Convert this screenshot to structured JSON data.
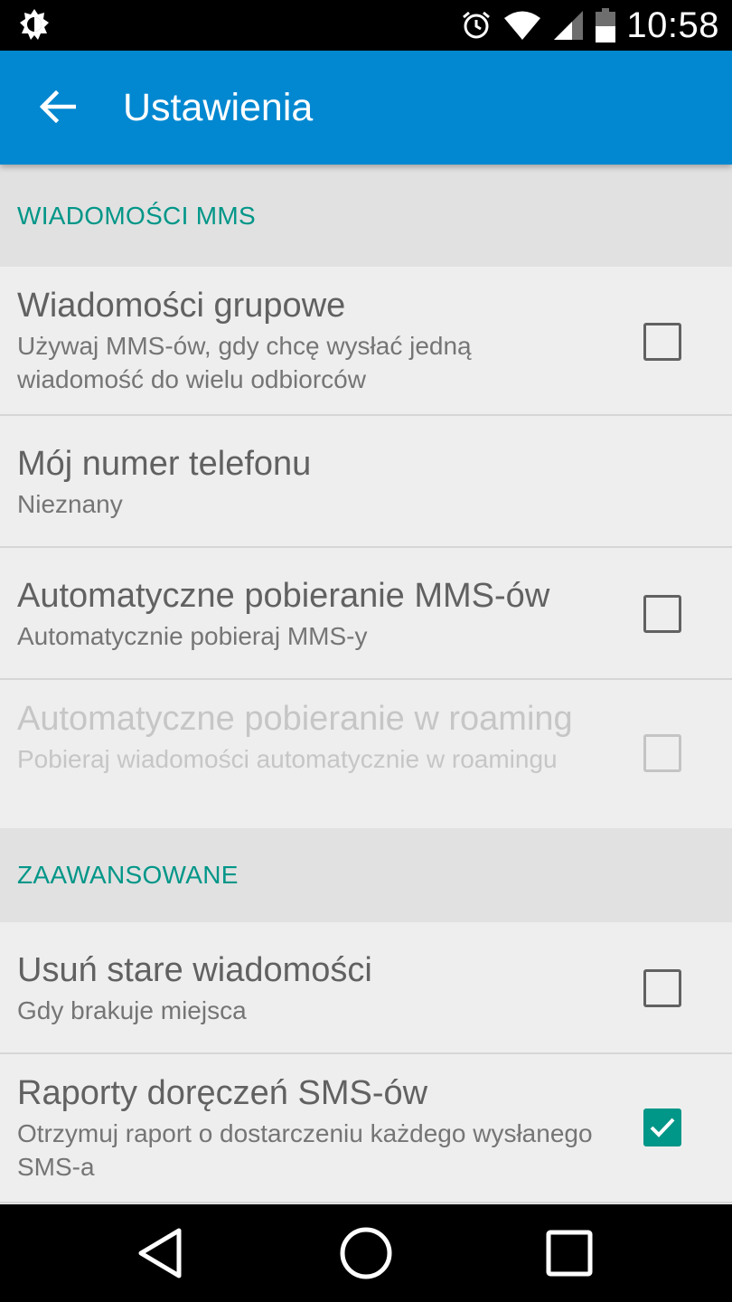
{
  "status_bar": {
    "time": "10:58",
    "icons": [
      "brightness-icon",
      "alarm-icon",
      "wifi-icon",
      "signal-icon",
      "battery-icon"
    ]
  },
  "app_bar": {
    "title": "Ustawienia",
    "color": "#0288d1"
  },
  "sections": [
    {
      "header": "WIADOMOŚCI MMS",
      "items": [
        {
          "title": "Wiadomości grupowe",
          "summary": "Używaj MMS-ów, gdy chcę wysłać jedną wiadomość do wielu odbiorców",
          "checkbox": true,
          "checked": false,
          "enabled": true
        },
        {
          "title": "Mój numer telefonu",
          "summary": "Nieznany",
          "checkbox": false,
          "enabled": true
        },
        {
          "title": "Automatyczne pobieranie MMS-ów",
          "summary": "Automatycznie pobieraj MMS-y",
          "checkbox": true,
          "checked": false,
          "enabled": true
        },
        {
          "title": "Automatyczne pobieranie w roaming",
          "summary": "Pobieraj wiadomości automatycznie w roamingu",
          "checkbox": true,
          "checked": false,
          "enabled": false
        }
      ]
    },
    {
      "header": "ZAAWANSOWANE",
      "items": [
        {
          "title": "Usuń stare wiadomości",
          "summary": "Gdy brakuje miejsca",
          "checkbox": true,
          "checked": false,
          "enabled": true
        },
        {
          "title": "Raporty doręczeń SMS-ów",
          "summary": "Otrzymuj raport o dostarczeniu każdego wysłanego SMS-a",
          "checkbox": true,
          "checked": true,
          "enabled": true
        }
      ]
    }
  ],
  "colors": {
    "accent": "#009688",
    "section_header_bg": "#e1e1e1",
    "list_bg": "#eeeeee"
  },
  "nav_bar": {
    "icons": [
      "back-triangle-icon",
      "home-circle-icon",
      "recents-square-icon"
    ]
  }
}
